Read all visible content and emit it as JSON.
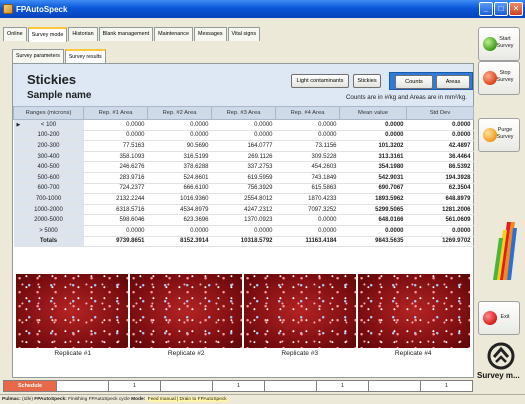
{
  "window": {
    "title": "FPAutoSpeck"
  },
  "tabs": [
    "Online",
    "Survey mode",
    "Historian",
    "Blank management",
    "Maintenance",
    "Messages",
    "Vital signs"
  ],
  "active_tab": "Survey mode",
  "subtabs": [
    "Survey parameters",
    "Survey results"
  ],
  "active_subtab": "Survey results",
  "header": {
    "title": "Stickies",
    "sample_name": "Sample name",
    "btn_light": "Light contaminants",
    "btn_stickies": "Stickies",
    "btn_counts": "Counts",
    "btn_areas": "Areas",
    "units_note": "Counts are in #/kg and Areas are in mm²/kg."
  },
  "table": {
    "columns": [
      "Ranges (microns)",
      "Rep. #1 Area",
      "Rep. #2 Area",
      "Rep. #3 Area",
      "Rep. #4 Area",
      "Mean value",
      "Std Dev"
    ],
    "rows": [
      [
        "< 100",
        "0.0000",
        "0.0000",
        "0.0000",
        "0.0000",
        "0.0000",
        "0.0000"
      ],
      [
        "100-200",
        "0.0000",
        "0.0000",
        "0.0000",
        "0.0000",
        "0.0000",
        "0.0000"
      ],
      [
        "200-300",
        "77.5163",
        "90.5690",
        "164.0777",
        "73.1156",
        "101.3202",
        "42.4897"
      ],
      [
        "300-400",
        "358.1093",
        "316.5199",
        "269.1126",
        "309.5228",
        "313.3161",
        "36.4464"
      ],
      [
        "400-500",
        "246.6276",
        "378.6288",
        "337.2753",
        "454.2603",
        "354.1980",
        "86.5392"
      ],
      [
        "500-600",
        "283.9716",
        "524.8601",
        "619.5959",
        "743.1849",
        "542.9031",
        "194.3928"
      ],
      [
        "600-700",
        "724.2377",
        "666.6100",
        "756.3929",
        "615.5863",
        "690.7067",
        "62.3504"
      ],
      [
        "700-1000",
        "2132.2244",
        "1016.9360",
        "2554.8012",
        "1870.4233",
        "1893.5962",
        "648.8979"
      ],
      [
        "1000-2000",
        "6318.5716",
        "4534.8979",
        "4247.2312",
        "7097.3252",
        "5299.5065",
        "1281.2006"
      ],
      [
        "2000-5000",
        "598.6046",
        "623.3696",
        "1370.0923",
        "0.0000",
        "648.0166",
        "561.0609"
      ],
      [
        "> 5000",
        "0.0000",
        "0.0000",
        "0.0000",
        "0.0000",
        "0.0000",
        "0.0000"
      ],
      [
        "Totals",
        "9739.8651",
        "8152.3914",
        "10318.5792",
        "11163.4184",
        "9843.5635",
        "1269.9702"
      ]
    ]
  },
  "replicates": [
    "Replicate #1",
    "Replicate #2",
    "Replicate #3",
    "Replicate #4"
  ],
  "side": {
    "start": "Start Survey",
    "stop": "Stop Survey",
    "purge": "Purge Survey",
    "exit": "Exit",
    "survey_label": "Survey m..."
  },
  "bottom": {
    "schedule": "Schedule",
    "slots": [
      "",
      "1",
      "",
      "1",
      "",
      "1",
      "",
      "1"
    ]
  },
  "status": {
    "prefix": "Pulmac: ",
    "state": "(Idle)",
    "app": "FPAutoSpeck:",
    "message": "Finishing FPAutoSpeck cycle",
    "mode_label": "Mode:",
    "mode_value": "Feed manual | Drain to FPAutoSpeck"
  },
  "colors": {
    "title_bar": "#0a57d8",
    "header_band": "#dde8f4",
    "toggle_group": "#2f7bd9",
    "schedule": "#e8684a"
  }
}
